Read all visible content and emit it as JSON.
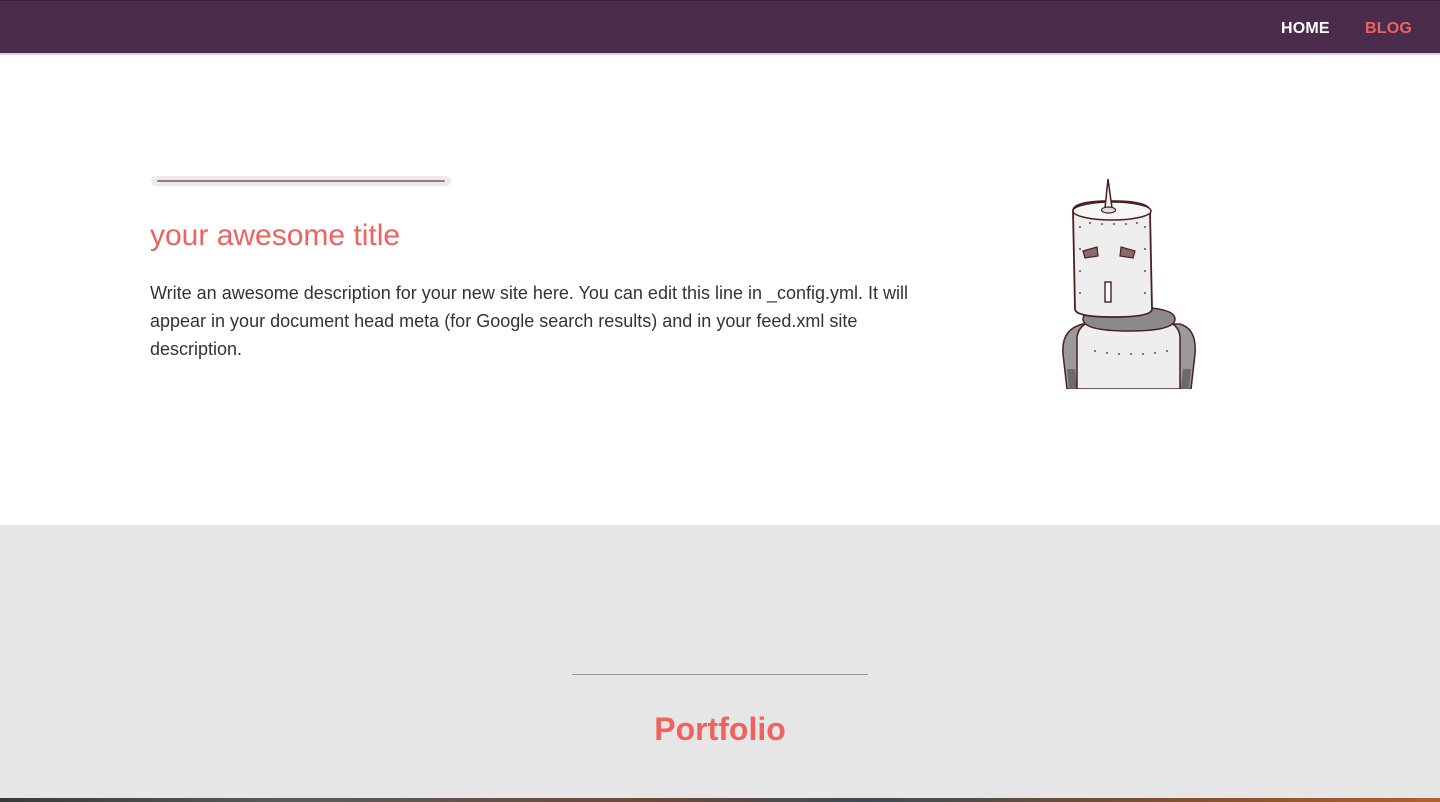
{
  "nav": {
    "home_label": "HOME",
    "blog_label": "BLOG"
  },
  "hero": {
    "title": "your awesome title",
    "description": "Write an awesome description for your new site here. You can edit this line in _config.yml. It will appear in your document head meta (for Google search results) and in your feed.xml site description.",
    "illustration": "robot-knight-illustration"
  },
  "portfolio": {
    "title": "Portfolio"
  },
  "colors": {
    "navbar": "#4a2c4d",
    "accent": "#f0625d",
    "portfolio_bg": "#e6e6e6"
  }
}
